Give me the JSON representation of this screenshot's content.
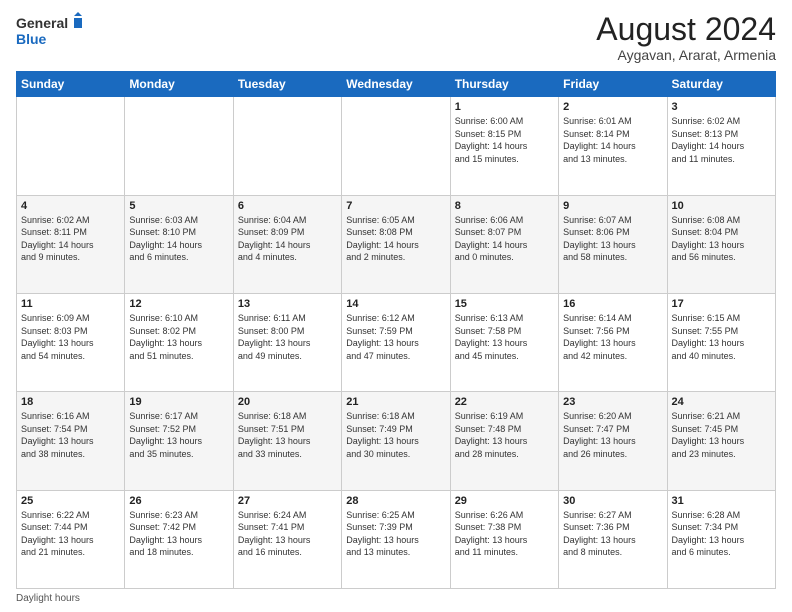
{
  "logo": {
    "text_general": "General",
    "text_blue": "Blue"
  },
  "title": "August 2024",
  "subtitle": "Aygavan, Ararat, Armenia",
  "days_header": [
    "Sunday",
    "Monday",
    "Tuesday",
    "Wednesday",
    "Thursday",
    "Friday",
    "Saturday"
  ],
  "footer": "Daylight hours",
  "weeks": [
    [
      {
        "day": "",
        "info": ""
      },
      {
        "day": "",
        "info": ""
      },
      {
        "day": "",
        "info": ""
      },
      {
        "day": "",
        "info": ""
      },
      {
        "day": "1",
        "info": "Sunrise: 6:00 AM\nSunset: 8:15 PM\nDaylight: 14 hours\nand 15 minutes."
      },
      {
        "day": "2",
        "info": "Sunrise: 6:01 AM\nSunset: 8:14 PM\nDaylight: 14 hours\nand 13 minutes."
      },
      {
        "day": "3",
        "info": "Sunrise: 6:02 AM\nSunset: 8:13 PM\nDaylight: 14 hours\nand 11 minutes."
      }
    ],
    [
      {
        "day": "4",
        "info": "Sunrise: 6:02 AM\nSunset: 8:11 PM\nDaylight: 14 hours\nand 9 minutes."
      },
      {
        "day": "5",
        "info": "Sunrise: 6:03 AM\nSunset: 8:10 PM\nDaylight: 14 hours\nand 6 minutes."
      },
      {
        "day": "6",
        "info": "Sunrise: 6:04 AM\nSunset: 8:09 PM\nDaylight: 14 hours\nand 4 minutes."
      },
      {
        "day": "7",
        "info": "Sunrise: 6:05 AM\nSunset: 8:08 PM\nDaylight: 14 hours\nand 2 minutes."
      },
      {
        "day": "8",
        "info": "Sunrise: 6:06 AM\nSunset: 8:07 PM\nDaylight: 14 hours\nand 0 minutes."
      },
      {
        "day": "9",
        "info": "Sunrise: 6:07 AM\nSunset: 8:06 PM\nDaylight: 13 hours\nand 58 minutes."
      },
      {
        "day": "10",
        "info": "Sunrise: 6:08 AM\nSunset: 8:04 PM\nDaylight: 13 hours\nand 56 minutes."
      }
    ],
    [
      {
        "day": "11",
        "info": "Sunrise: 6:09 AM\nSunset: 8:03 PM\nDaylight: 13 hours\nand 54 minutes."
      },
      {
        "day": "12",
        "info": "Sunrise: 6:10 AM\nSunset: 8:02 PM\nDaylight: 13 hours\nand 51 minutes."
      },
      {
        "day": "13",
        "info": "Sunrise: 6:11 AM\nSunset: 8:00 PM\nDaylight: 13 hours\nand 49 minutes."
      },
      {
        "day": "14",
        "info": "Sunrise: 6:12 AM\nSunset: 7:59 PM\nDaylight: 13 hours\nand 47 minutes."
      },
      {
        "day": "15",
        "info": "Sunrise: 6:13 AM\nSunset: 7:58 PM\nDaylight: 13 hours\nand 45 minutes."
      },
      {
        "day": "16",
        "info": "Sunrise: 6:14 AM\nSunset: 7:56 PM\nDaylight: 13 hours\nand 42 minutes."
      },
      {
        "day": "17",
        "info": "Sunrise: 6:15 AM\nSunset: 7:55 PM\nDaylight: 13 hours\nand 40 minutes."
      }
    ],
    [
      {
        "day": "18",
        "info": "Sunrise: 6:16 AM\nSunset: 7:54 PM\nDaylight: 13 hours\nand 38 minutes."
      },
      {
        "day": "19",
        "info": "Sunrise: 6:17 AM\nSunset: 7:52 PM\nDaylight: 13 hours\nand 35 minutes."
      },
      {
        "day": "20",
        "info": "Sunrise: 6:18 AM\nSunset: 7:51 PM\nDaylight: 13 hours\nand 33 minutes."
      },
      {
        "day": "21",
        "info": "Sunrise: 6:18 AM\nSunset: 7:49 PM\nDaylight: 13 hours\nand 30 minutes."
      },
      {
        "day": "22",
        "info": "Sunrise: 6:19 AM\nSunset: 7:48 PM\nDaylight: 13 hours\nand 28 minutes."
      },
      {
        "day": "23",
        "info": "Sunrise: 6:20 AM\nSunset: 7:47 PM\nDaylight: 13 hours\nand 26 minutes."
      },
      {
        "day": "24",
        "info": "Sunrise: 6:21 AM\nSunset: 7:45 PM\nDaylight: 13 hours\nand 23 minutes."
      }
    ],
    [
      {
        "day": "25",
        "info": "Sunrise: 6:22 AM\nSunset: 7:44 PM\nDaylight: 13 hours\nand 21 minutes."
      },
      {
        "day": "26",
        "info": "Sunrise: 6:23 AM\nSunset: 7:42 PM\nDaylight: 13 hours\nand 18 minutes."
      },
      {
        "day": "27",
        "info": "Sunrise: 6:24 AM\nSunset: 7:41 PM\nDaylight: 13 hours\nand 16 minutes."
      },
      {
        "day": "28",
        "info": "Sunrise: 6:25 AM\nSunset: 7:39 PM\nDaylight: 13 hours\nand 13 minutes."
      },
      {
        "day": "29",
        "info": "Sunrise: 6:26 AM\nSunset: 7:38 PM\nDaylight: 13 hours\nand 11 minutes."
      },
      {
        "day": "30",
        "info": "Sunrise: 6:27 AM\nSunset: 7:36 PM\nDaylight: 13 hours\nand 8 minutes."
      },
      {
        "day": "31",
        "info": "Sunrise: 6:28 AM\nSunset: 7:34 PM\nDaylight: 13 hours\nand 6 minutes."
      }
    ]
  ]
}
